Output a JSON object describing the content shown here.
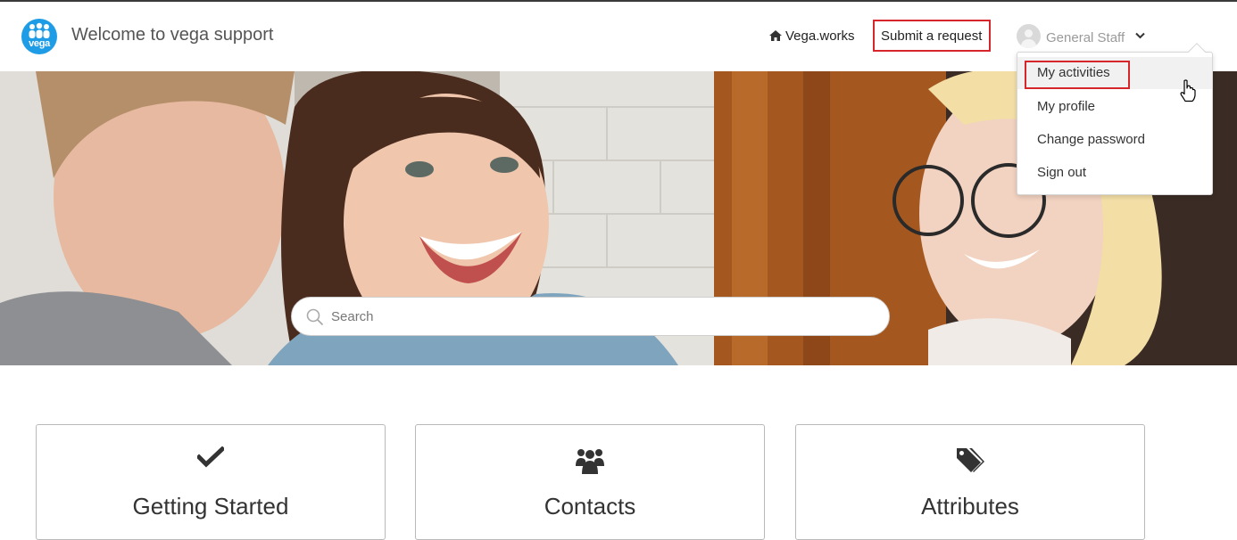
{
  "header": {
    "logo_text": "vega",
    "title": "Welcome to vega support",
    "nav": {
      "vega_works_label": "Vega.works",
      "submit_request_label": "Submit a request"
    },
    "user": {
      "name": "General Staff"
    }
  },
  "user_menu": {
    "items": [
      {
        "label": "My activities"
      },
      {
        "label": "My profile"
      },
      {
        "label": "Change password"
      },
      {
        "label": "Sign out"
      }
    ]
  },
  "search": {
    "placeholder": "Search"
  },
  "cards": [
    {
      "title": "Getting Started",
      "icon": "checkmark-icon"
    },
    {
      "title": "Contacts",
      "icon": "users-icon"
    },
    {
      "title": "Attributes",
      "icon": "tags-icon"
    }
  ],
  "colors": {
    "accent_logo": "#1e9ce6",
    "highlight_box": "#d7262b"
  }
}
